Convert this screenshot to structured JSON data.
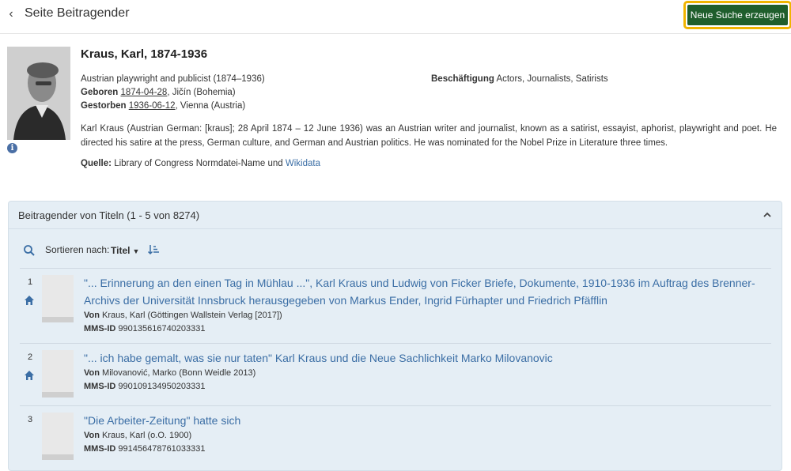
{
  "header": {
    "back_icon": "chevron-left-icon",
    "title": "Seite Beitragender",
    "new_search_label": "Neue Suche erzeugen",
    "accent_color": "#1f5e2c",
    "focus_ring_color": "#f0b400"
  },
  "person": {
    "name": "Kraus, Karl, 1874-1936",
    "description": "Austrian playwright and publicist (1874–1936)",
    "born_label": "Geboren",
    "born_date": "1874-04-28",
    "born_place": ", Jičín (Bohemia)",
    "died_label": "Gestorben",
    "died_date": "1936-06-12",
    "died_place": ", Vienna (Austria)",
    "occupation_label": "Beschäftigung",
    "occupation_value": "Actors, Journalists, Satirists",
    "bio": "Karl Kraus (Austrian German: [kraus]; 28 April 1874 – 12 June 1936) was an Austrian writer and journalist, known as a satirist, essayist, aphorist, playwright and poet. He directed his satire at the press, German culture, and German and Austrian politics. He was nominated for the Nobel Prize in Literature three times.",
    "source_label": "Quelle:",
    "source_text": "Library of Congress Normdatei-Name und",
    "source_link": "Wikidata"
  },
  "results": {
    "title": "Beitragender von Titeln (1 - 5 von 8274)",
    "sort_label": "Sortieren nach:",
    "sort_value": "Titel",
    "items": [
      {
        "num": "1",
        "title": "\"... Erinnerung an den einen Tag in Mühlau ...\", Karl Kraus und Ludwig von Ficker Briefe, Dokumente, 1910-1936 im Auftrag des Brenner-Archivs der Universität Innsbruck herausgegeben von Markus Ender, Ingrid Fürhapter und Friedrich Pfäfflin",
        "von_label": "Von",
        "von_value": "Kraus, Karl (Göttingen Wallstein Verlag [2017])",
        "mms_label": "MMS-ID",
        "mms_value": "990135616740203331"
      },
      {
        "num": "2",
        "title": "\"... ich habe gemalt, was sie nur taten\" Karl Kraus und die Neue Sachlichkeit Marko Milovanovic",
        "von_label": "Von",
        "von_value": "Milovanović, Marko (Bonn Weidle 2013)",
        "mms_label": "MMS-ID",
        "mms_value": "990109134950203331"
      },
      {
        "num": "3",
        "title": "\"Die Arbeiter-Zeitung\" hatte sich",
        "von_label": "Von",
        "von_value": "Kraus, Karl (o.O. 1900)",
        "mms_label": "MMS-ID",
        "mms_value": "991456478761033331"
      }
    ]
  }
}
